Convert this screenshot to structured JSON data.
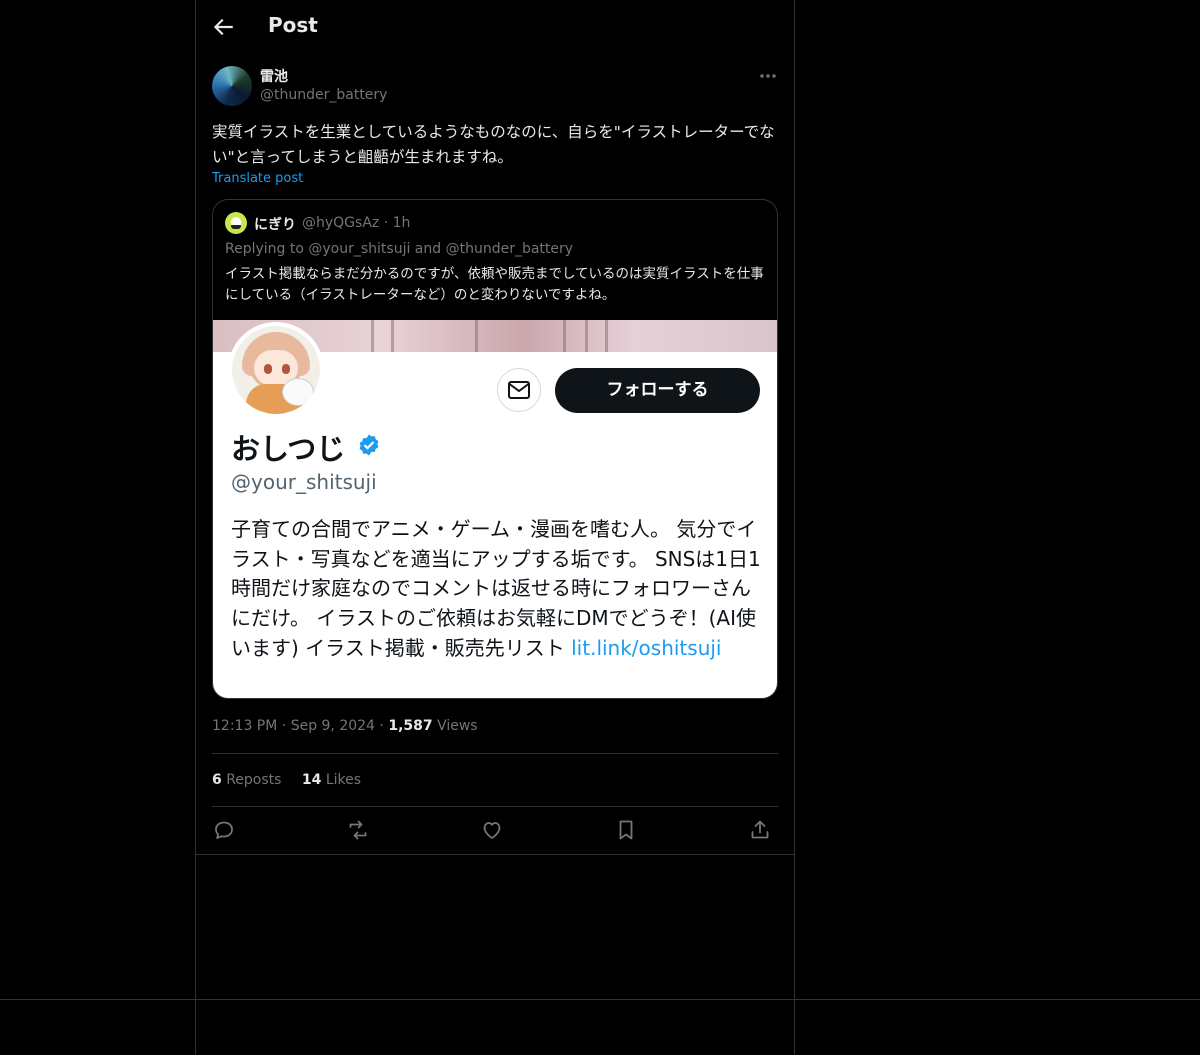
{
  "header": {
    "title": "Post"
  },
  "post": {
    "author_name": "雷池",
    "author_handle": "@thunder_battery",
    "text": "実質イラストを生業としているようなものなのに、自らを\"イラストレーターでない\"と言ってしまうと齟齬が生まれますね。",
    "translate_label": "Translate post",
    "time": "12:13 PM",
    "date": "Sep 9, 2024",
    "views_count": "1,587",
    "views_label": "Views",
    "reposts_count": "6",
    "reposts_label": "Reposts",
    "likes_count": "14",
    "likes_label": "Likes"
  },
  "quote": {
    "name": "にぎり",
    "handle": "@hyQGsAz",
    "time": "1h",
    "replying_to": "Replying to @your_shitsuji and @thunder_battery",
    "text": "イラスト掲載ならまだ分かるのですが、依頼や販売までしているのは実質イラストを仕事にしている（イラストレーターなど）のと変わりないですよね。"
  },
  "embedded_profile": {
    "follow_label": "フォローする",
    "name": "おしつじ",
    "handle": "@your_shitsuji",
    "bio": "子育ての合間でアニメ・ゲーム・漫画を嗜む人。 気分でイラスト・写真などを適当にアップする垢です。 SNSは1日1時間だけ家庭なのでコメントは返せる時にフォロワーさんにだけ。 イラストのご依頼はお気軽にDMでどうぞ！(AI使います) イラスト掲載・販売先リスト ",
    "bio_link": "lit.link/oshitsuji"
  },
  "colors": {
    "background": "#000000",
    "text": "#e7e9ea",
    "muted": "#71767b",
    "accent": "#1d9bf0",
    "border": "#2f3336"
  },
  "icons": {
    "back": "arrow-left-icon",
    "more": "more-horizontal-icon",
    "reply": "reply-icon",
    "repost": "repost-icon",
    "like": "heart-icon",
    "bookmark": "bookmark-icon",
    "share": "share-icon",
    "mail": "mail-icon",
    "verified": "verified-badge-icon"
  }
}
